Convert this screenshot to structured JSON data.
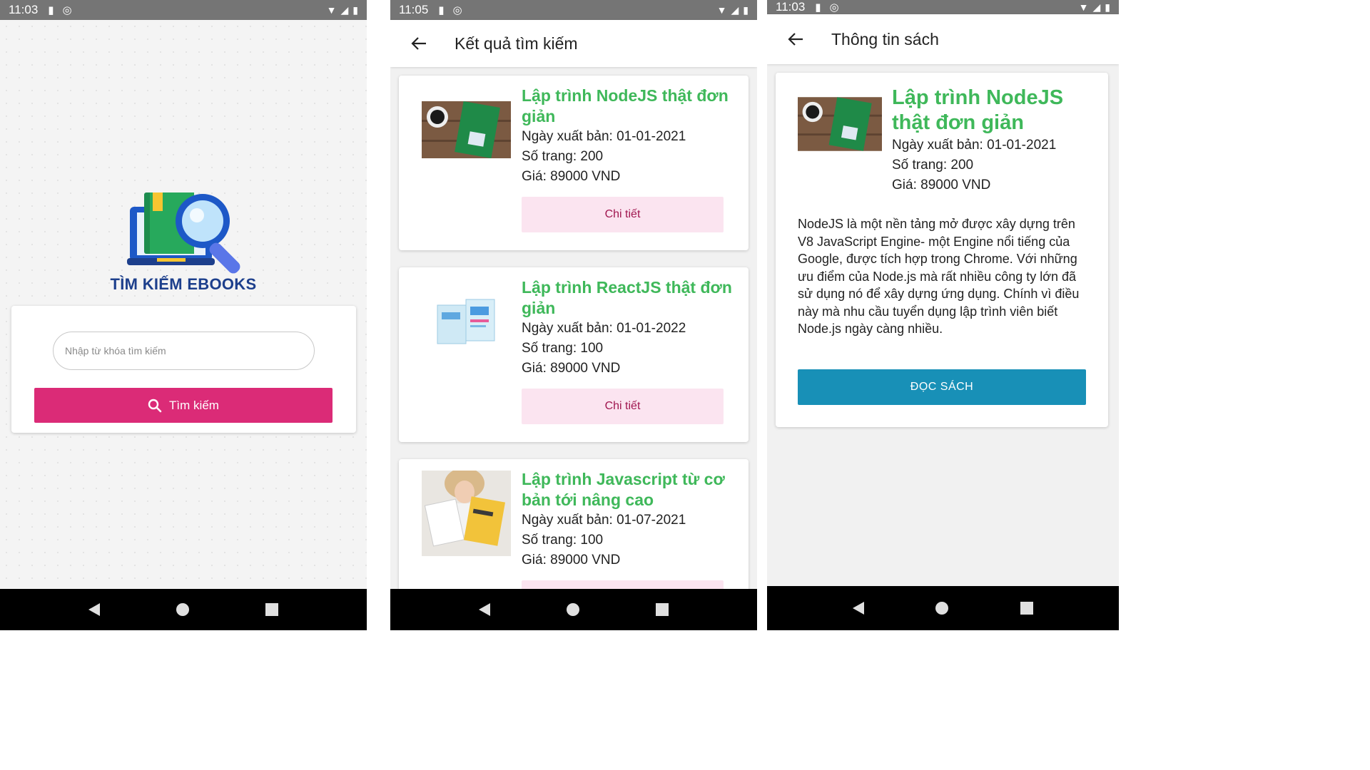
{
  "screens": {
    "search": {
      "status": {
        "time": "11:03"
      },
      "logo_title": "TÌM KIẾM EBOOKS",
      "search_placeholder": "Nhập từ khóa tìm kiếm",
      "search_button": "Tìm kiếm"
    },
    "results": {
      "status": {
        "time": "11:05"
      },
      "title": "Kết quả tìm kiếm",
      "detail_button": "Chi tiết",
      "books": [
        {
          "title": "Lập trình NodeJS thật đơn giản",
          "date": "Ngày xuất bản: 01-01-2021",
          "pages": "Số trang: 200",
          "price": "Giá: 89000 VND",
          "thumb": "nodejs-book-cover"
        },
        {
          "title": "Lập trình ReactJS thật đơn giản",
          "date": "Ngày xuất bản: 01-01-2022",
          "pages": "Số trang: 100",
          "price": "Giá: 89000 VND",
          "thumb": "reactjs-book-cover"
        },
        {
          "title": "Lập trình Javascript từ cơ bản tới nâng cao",
          "date": "Ngày xuất bản: 01-07-2021",
          "pages": "Số trang: 100",
          "price": "Giá: 89000 VND",
          "thumb": "javascript-book-photo"
        }
      ]
    },
    "detail": {
      "status": {
        "time": "11:03"
      },
      "title": "Thông tin sách",
      "book": {
        "title": "Lập trình NodeJS thật đơn giản",
        "date": "Ngày xuất bản: 01-01-2021",
        "pages": "Số trang: 200",
        "price": "Giá: 89000 VND"
      },
      "description": "NodeJS là một nền tảng mở được xây dựng trên V8 JavaScript Engine- một Engine nổi tiếng của Google, được tích hợp trong Chrome. Với những ưu điểm của Node.js mà rất nhiều công ty lớn đã sử dụng nó để xây dựng ứng dụng. Chính vì điều này mà nhu cầu tuyển dụng lập trình viên biết Node.js ngày càng nhiều.",
      "read_button": "ĐỌC SÁCH"
    }
  },
  "colors": {
    "accent_pink": "#db2b77",
    "title_green": "#3fb85a",
    "read_blue": "#1890b7",
    "logo_navy": "#1d3f8c"
  }
}
